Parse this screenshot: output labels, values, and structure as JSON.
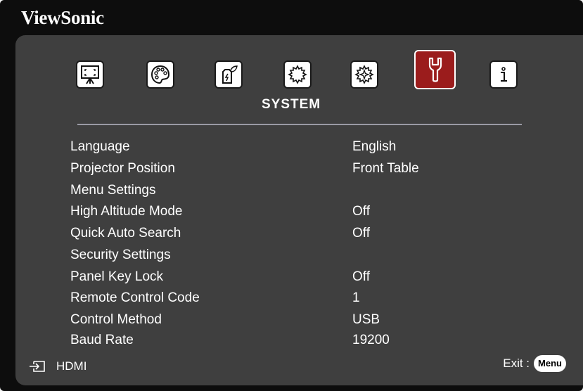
{
  "brand": "ViewSonic",
  "tabs": [
    {
      "icon": "display-icon",
      "active": false
    },
    {
      "icon": "color-palette-icon",
      "active": false
    },
    {
      "icon": "power-eco-icon",
      "active": false
    },
    {
      "icon": "basic-gear-icon",
      "active": false
    },
    {
      "icon": "advanced-gear-icon",
      "active": false
    },
    {
      "icon": "wrench-system-icon",
      "active": true
    },
    {
      "icon": "info-icon",
      "active": false
    }
  ],
  "section_title": "SYSTEM",
  "menu": [
    {
      "label": "Language",
      "value": "English"
    },
    {
      "label": "Projector Position",
      "value": "Front Table"
    },
    {
      "label": "Menu Settings",
      "value": ""
    },
    {
      "label": "High Altitude Mode",
      "value": "Off"
    },
    {
      "label": "Quick Auto Search",
      "value": "Off"
    },
    {
      "label": "Security Settings",
      "value": ""
    },
    {
      "label": "Panel Key Lock",
      "value": "Off"
    },
    {
      "label": "Remote Control Code",
      "value": "1"
    },
    {
      "label": "Control Method",
      "value": "USB"
    },
    {
      "label": "Baud Rate",
      "value": "19200"
    }
  ],
  "footer": {
    "source": "HDMI",
    "exit_label": "Exit :",
    "menu_button": "Menu"
  },
  "colors": {
    "panel": "#3f3f3f",
    "active_tab": "#9b1c1c",
    "text": "#ffffff"
  }
}
